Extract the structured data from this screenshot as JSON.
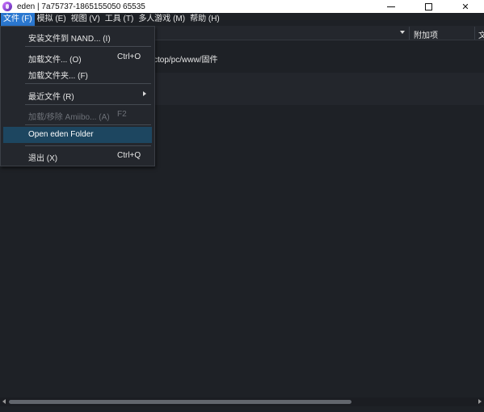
{
  "window": {
    "title": "eden | 7a75737-1865155050 65535",
    "icon": "eden-app-icon",
    "controls": {
      "minimize": "",
      "maximize": "",
      "close": "✕"
    }
  },
  "menubar": {
    "items": [
      {
        "label": "文件 (F)",
        "active": true
      },
      {
        "label": "模拟 (E)"
      },
      {
        "label": "视图 (V)"
      },
      {
        "label": "工具 (T)"
      },
      {
        "label": "多人游戏 (M)"
      },
      {
        "label": "帮助 (H)"
      }
    ]
  },
  "file_menu": {
    "items": [
      {
        "label": "安装文件到 NAND... (I)",
        "shortcut": ""
      },
      {
        "label": "加载文件... (O)",
        "shortcut": "Ctrl+O"
      },
      {
        "label": "加载文件夹... (F)",
        "shortcut": ""
      },
      {
        "label": "最近文件 (R)",
        "shortcut": "",
        "submenu": true
      },
      {
        "label": "加载/移除 Amiibo... (A)",
        "shortcut": "F2",
        "disabled": true
      },
      {
        "label": "Open eden Folder",
        "shortcut": "",
        "highlighted": true
      },
      {
        "label": "退出 (X)",
        "shortcut": "Ctrl+Q"
      }
    ]
  },
  "game_list": {
    "columns": {
      "addons": "附加项",
      "partial": "文"
    },
    "path": "ctop/pc/www/固件"
  },
  "colors": {
    "background": "#1e2126",
    "menu_active": "#2b78d0",
    "menu_highlight": "#1d4660"
  }
}
